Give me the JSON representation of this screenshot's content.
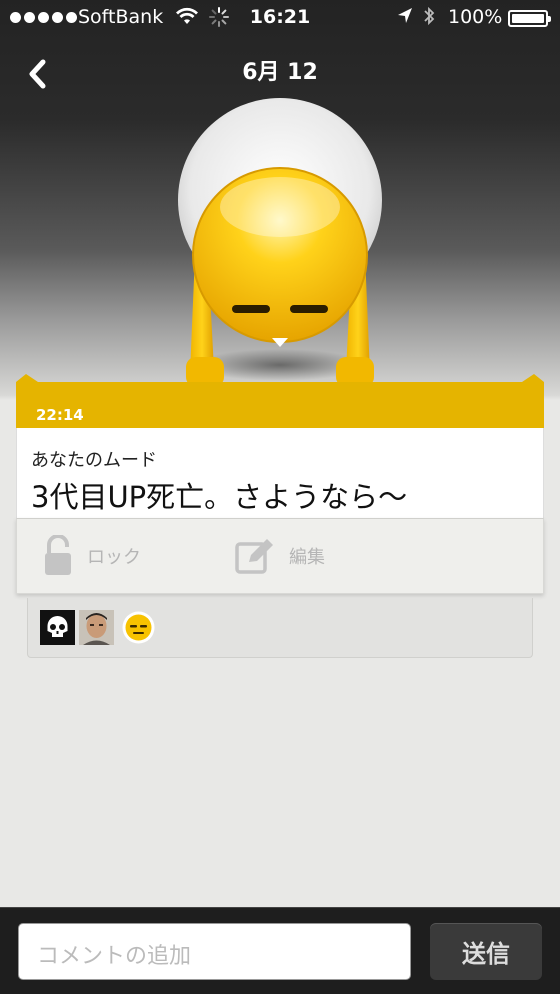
{
  "status_bar": {
    "carrier": "SoftBank",
    "time": "16:21",
    "battery": "100%"
  },
  "nav": {
    "title": "6月 12"
  },
  "card": {
    "time": "22:14",
    "mood_caption": "あなたのムード",
    "mood_text": "3代目UP死亡。さようなら〜",
    "lock_label": "ロック",
    "edit_label": "編集"
  },
  "comment": {
    "placeholder": "コメントの追加",
    "send_label": "送信"
  },
  "colors": {
    "accent": "#e5b400",
    "mascot_yellow": "#f5c400"
  },
  "icons": [
    "back-chevron-icon",
    "wifi-icon",
    "activity-spinner-icon",
    "location-arrow-icon",
    "bluetooth-icon",
    "battery-icon",
    "lock-icon",
    "edit-icon",
    "skull-icon",
    "face-meh-icon"
  ]
}
